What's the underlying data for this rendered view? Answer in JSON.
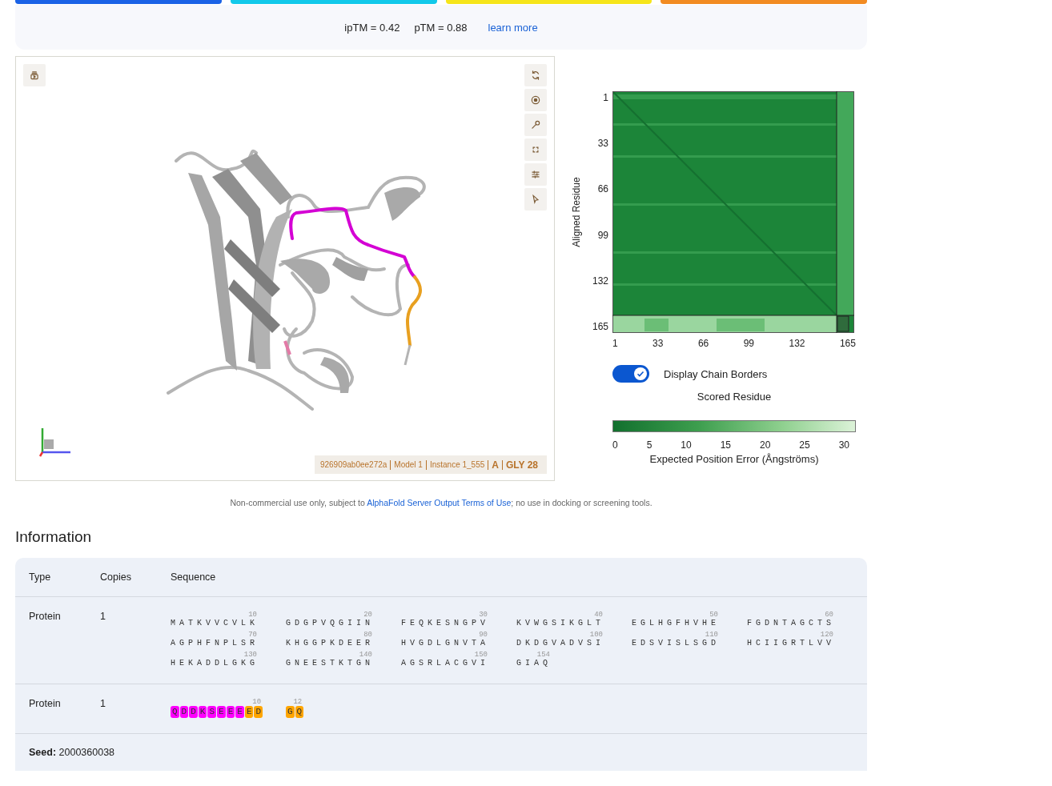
{
  "quality_bars": [
    {
      "color": "#1a62e6"
    },
    {
      "color": "#12c9ea"
    },
    {
      "color": "#f6e51a"
    },
    {
      "color": "#f28b22"
    }
  ],
  "metrics": {
    "iptm": "ipTM = 0.42",
    "ptm": "pTM = 0.88",
    "link": "learn more"
  },
  "viewer": {
    "info": {
      "entry": "926909ab0ee272a",
      "model": "Model 1",
      "instance": "Instance 1_555",
      "chain": "A",
      "residue": "GLY 28"
    }
  },
  "pae": {
    "y_label": "Aligned Residue",
    "y_ticks": [
      "1",
      "33",
      "66",
      "99",
      "132",
      "165"
    ],
    "x_ticks": [
      "1",
      "33",
      "66",
      "99",
      "132",
      "165"
    ],
    "toggle": {
      "label": "Display Chain Borders",
      "on": true
    },
    "x_label": "Scored Residue",
    "colorbar": {
      "ticks": [
        "0",
        "5",
        "10",
        "15",
        "20",
        "25",
        "30"
      ],
      "label": "Expected Position Error (Ångströms)"
    }
  },
  "notice": {
    "before": "Non-commercial use only, subject to",
    "link": "AlphaFold Server Output Terms of Use",
    "after": "; no use in docking or screening tools."
  },
  "information": {
    "title": "Information",
    "columns": [
      "Type",
      "Copies",
      "Sequence"
    ],
    "rows": [
      {
        "type": "Protein",
        "copies": "1",
        "kind": "plain",
        "segments": [
          {
            "number": "10",
            "residues": "MATKVVCVLK"
          },
          {
            "number": "20",
            "residues": "GDGPVQGIIN"
          },
          {
            "number": "30",
            "residues": "FEQKESNGPV"
          },
          {
            "number": "40",
            "residues": "KVWGSIKGLT"
          },
          {
            "number": "50",
            "residues": "EGLHGFHVHE"
          },
          {
            "number": "60",
            "residues": "FGDNTAGCTS"
          },
          {
            "number": "70",
            "residues": "AGPHFNPLSR"
          },
          {
            "number": "80",
            "residues": "KHGGPKDEER"
          },
          {
            "number": "90",
            "residues": "HVGDLGNVTA"
          },
          {
            "number": "100",
            "residues": "DKDGVADVSI"
          },
          {
            "number": "110",
            "residues": "EDSVISLSGD"
          },
          {
            "number": "120",
            "residues": "HCIIGRTLVV"
          },
          {
            "number": "130",
            "residues": "HEKADDLGKG"
          },
          {
            "number": "140",
            "residues": "GNEESTKTGN"
          },
          {
            "number": "150",
            "residues": "AGSRLACGVI"
          },
          {
            "number": "154",
            "residues": "GIAQ"
          }
        ]
      },
      {
        "type": "Protein",
        "copies": "1",
        "kind": "colored",
        "segments": [
          {
            "number": "10",
            "residues": [
              {
                "letter": "Q",
                "color": "#ff00ff"
              },
              {
                "letter": "D",
                "color": "#ff00ff"
              },
              {
                "letter": "D",
                "color": "#ff00ff"
              },
              {
                "letter": "K",
                "color": "#ff00ff"
              },
              {
                "letter": "S",
                "color": "#ff00ff"
              },
              {
                "letter": "E",
                "color": "#ff00ff"
              },
              {
                "letter": "E",
                "color": "#ff00ff"
              },
              {
                "letter": "E",
                "color": "#ff00ff"
              },
              {
                "letter": "E",
                "color": "#ffa500"
              },
              {
                "letter": "D",
                "color": "#ffa500"
              }
            ]
          },
          {
            "number": "12",
            "residues": [
              {
                "letter": "G",
                "color": "#ffa500"
              },
              {
                "letter": "Q",
                "color": "#ffa500"
              }
            ]
          }
        ]
      }
    ],
    "seed": "**Seed:** 2000360038"
  }
}
